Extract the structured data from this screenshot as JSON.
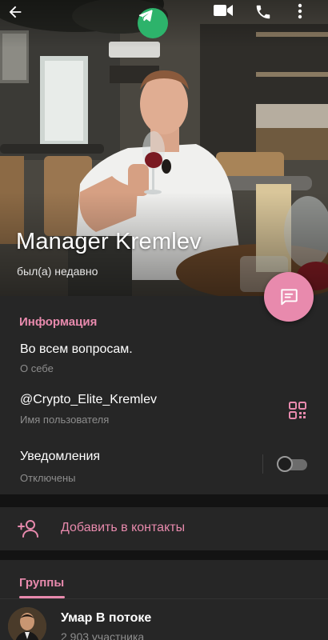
{
  "header": {
    "name": "Manager Kremlev",
    "status": "был(а) недавно",
    "icons": {
      "back": "back-arrow-icon",
      "badge": "telegram-icon",
      "video": "video-call-icon",
      "call": "phone-icon",
      "more": "more-vertical-icon",
      "message": "message-icon"
    }
  },
  "info": {
    "section_title": "Информация",
    "bio_value": "Во всем вопросам.",
    "bio_caption": "О себе",
    "username_value": "@Crypto_Elite_Kremlev",
    "username_caption": "Имя пользователя",
    "notifications_label": "Уведомления",
    "notifications_status": "Отключены",
    "notifications_enabled": false
  },
  "actions": {
    "add_contact": "Добавить в контакты"
  },
  "groups": {
    "tab_label": "Группы",
    "items": [
      {
        "name": "Умар В потоке",
        "members": "2 903 участника"
      }
    ]
  },
  "colors": {
    "accent": "#e88aad",
    "background": "#1f1f1f",
    "card": "#262626",
    "telegram_green": "#2db36b"
  }
}
